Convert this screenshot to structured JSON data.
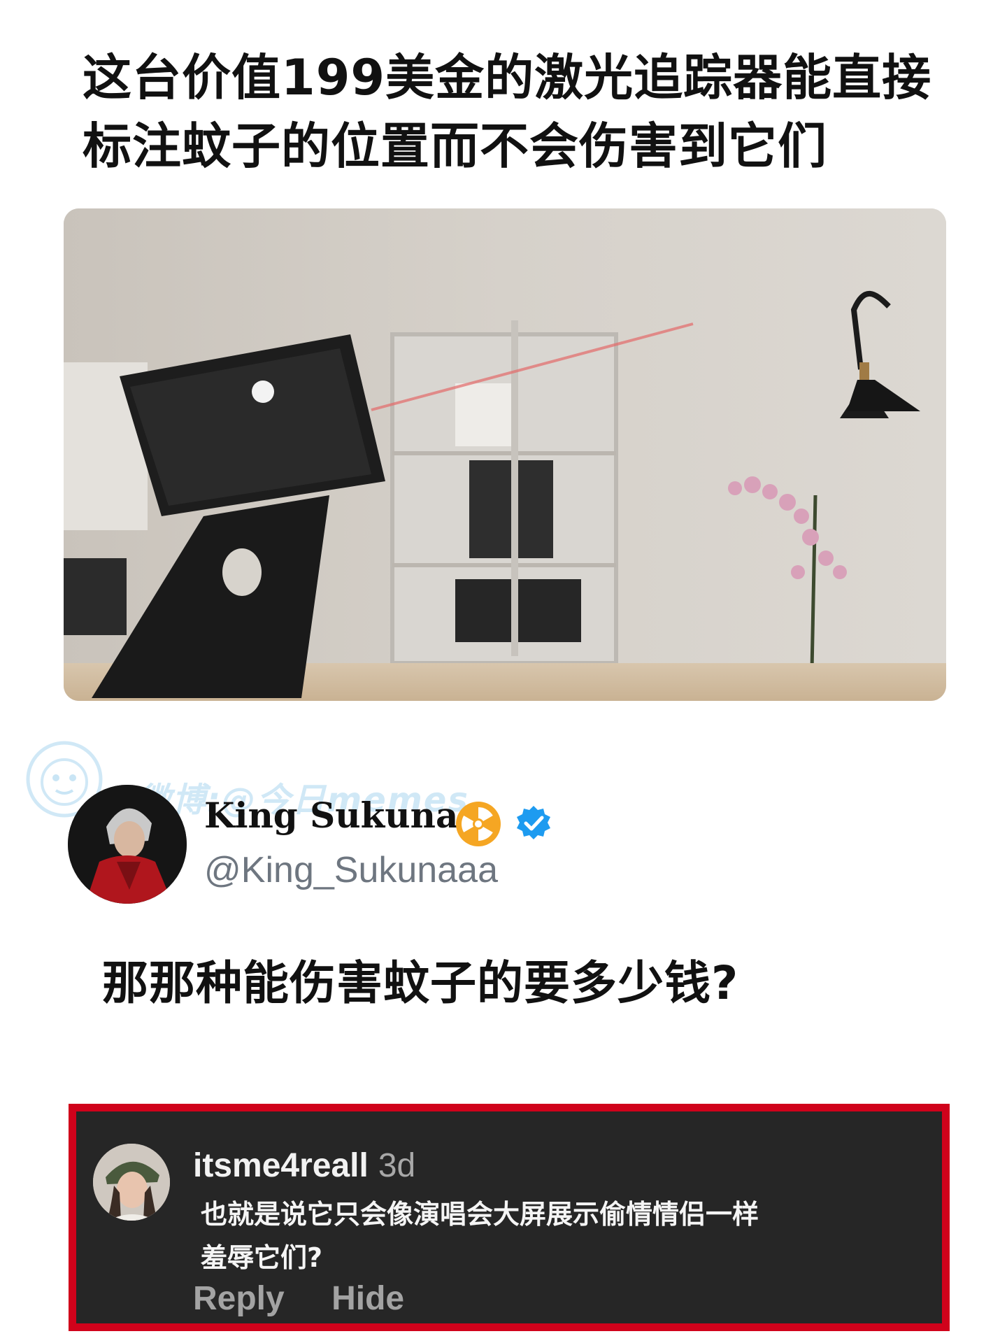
{
  "headline": {
    "line1": "这台价值199美金的激光追踪器能直接",
    "line2": "标注蚊子的位置而不会伤害到它们"
  },
  "watermark": {
    "text": "微博:@今日memes",
    "icon": "mascot-logo-icon"
  },
  "tweet": {
    "display_name": "King Sukuna",
    "handle": "@King_Sukunaaa",
    "name_badges": [
      "radioactive-icon",
      "verified-check-icon"
    ],
    "body": "那那种能伤害蚊子的要多少钱?",
    "avatar_icon": "avatar-image",
    "colors": {
      "verified": "#1d9bf0",
      "radioactive": "#f5a623",
      "handle": "#6e7680"
    }
  },
  "comment": {
    "username": "itsme4reall",
    "time_ago": "3d",
    "text_line1": "也就是说它只会像演唱会大屏展示偷情情侣一样",
    "text_line2": "羞辱它们?",
    "actions": {
      "reply": "Reply",
      "hide": "Hide"
    },
    "colors": {
      "border": "#d0021b",
      "background": "#262626"
    }
  }
}
